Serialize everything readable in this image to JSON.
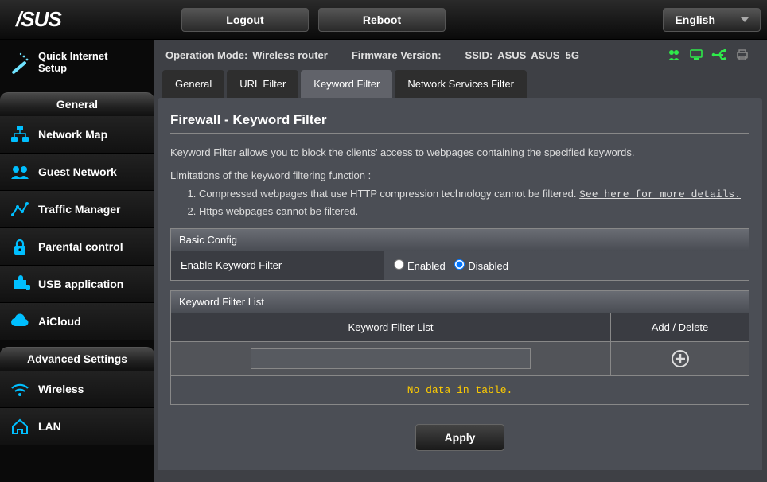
{
  "brand": "/SUS",
  "topbar": {
    "logout": "Logout",
    "reboot": "Reboot",
    "language": "English"
  },
  "status": {
    "opmode_label": "Operation Mode:",
    "opmode_value": "Wireless router",
    "fw_label": "Firmware Version:",
    "ssid_label": "SSID:",
    "ssid1": "ASUS",
    "ssid2": "ASUS_5G"
  },
  "sidebar": {
    "qis": "Quick Internet\nSetup",
    "general_head": "General",
    "advanced_head": "Advanced Settings",
    "items": {
      "network_map": "Network Map",
      "guest_network": "Guest Network",
      "traffic_manager": "Traffic Manager",
      "parental_control": "Parental control",
      "usb_application": "USB application",
      "aicloud": "AiCloud",
      "wireless": "Wireless",
      "lan": "LAN"
    }
  },
  "tabs": {
    "general": "General",
    "url_filter": "URL Filter",
    "keyword_filter": "Keyword Filter",
    "nsf": "Network Services Filter"
  },
  "page": {
    "title": "Firewall - Keyword Filter",
    "desc": "Keyword Filter allows you to block the clients' access to webpages containing the specified keywords.",
    "lim_label": "Limitations of the keyword filtering function :",
    "lim1_a": "Compressed webpages that use HTTP compression technology cannot be filtered. ",
    "lim1_link": "See here for more details.",
    "lim2": "Https webpages cannot be filtered.",
    "basic_head": "Basic Config",
    "enable_label": "Enable Keyword Filter",
    "enabled": "Enabled",
    "disabled": "Disabled",
    "kflist_head": "Keyword Filter List",
    "col_kw": "Keyword Filter List",
    "col_ad": "Add / Delete",
    "nodata": "No data in table.",
    "apply": "Apply"
  }
}
